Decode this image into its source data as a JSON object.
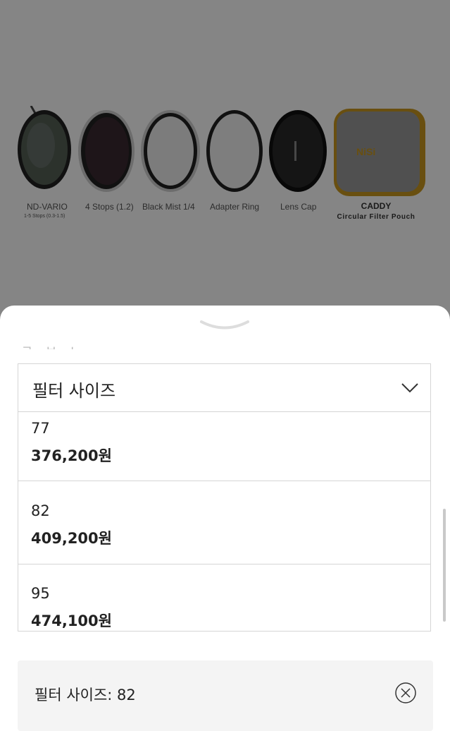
{
  "products": [
    {
      "name": "ND-VARIO",
      "sub": "1-5 Stops (0.3-1.5)"
    },
    {
      "name": "4 Stops (1.2)"
    },
    {
      "name": "Black Mist 1/4"
    },
    {
      "name": "Adapter Ring"
    },
    {
      "name": "Lens Cap"
    },
    {
      "name": "CADDY",
      "sub": "Circular Filter Pouch",
      "brand": "NiSi"
    }
  ],
  "sheet": {
    "select_label": "필터 사이즈",
    "options": [
      {
        "size": "77",
        "price": "376,200원"
      },
      {
        "size": "82",
        "price": "409,200원"
      },
      {
        "size": "95",
        "price": "474,100원"
      }
    ],
    "selected_text": "필터 사이즈: 82"
  },
  "colors": {
    "overlay": "#7a7a7a",
    "caddy_accent": "#c9981f",
    "border": "#d5d5d5",
    "panel_bg": "#f4f4f4"
  }
}
